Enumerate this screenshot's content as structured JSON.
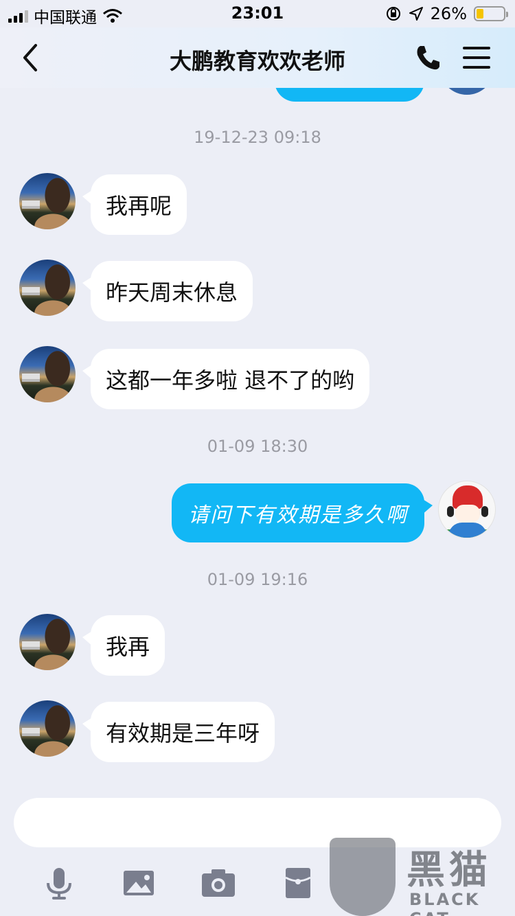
{
  "status_bar": {
    "carrier": "中国联通",
    "time": "23:01",
    "battery": "26%",
    "battery_level": 0.26
  },
  "header": {
    "title": "大鹏教育欢欢老师"
  },
  "messages": [
    {
      "type": "time",
      "text": "19-12-23 09:18"
    },
    {
      "type": "in",
      "text": "我再呢"
    },
    {
      "type": "in",
      "text": "昨天周末休息"
    },
    {
      "type": "in",
      "text": "这都一年多啦 退不了的哟"
    },
    {
      "type": "time",
      "text": "01-09 18:30"
    },
    {
      "type": "out",
      "text": "请问下有效期是多久啊"
    },
    {
      "type": "time",
      "text": "01-09 19:16"
    },
    {
      "type": "in",
      "text": "我再"
    },
    {
      "type": "in",
      "text": "有效期是三年呀"
    }
  ],
  "watermark": {
    "title": "黑猫",
    "subtitle": "BLACK CAT"
  },
  "colors": {
    "background": "#eceef6",
    "outgoing_bubble": "#12b7f5",
    "incoming_bubble": "#ffffff",
    "timestamp": "#9a9ba3"
  },
  "icons": [
    "microphone-icon",
    "image-icon",
    "camera-icon",
    "red-packet-icon"
  ]
}
